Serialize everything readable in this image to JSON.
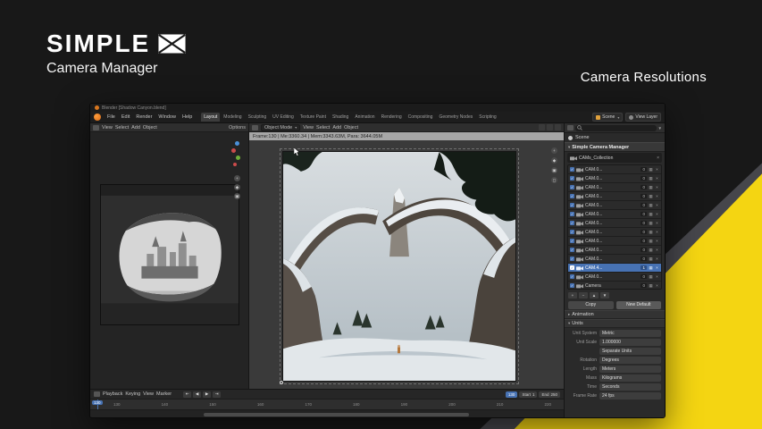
{
  "branding": {
    "title": "SIMPLE",
    "subtitle": "Camera Manager",
    "heading": "Camera Resolutions"
  },
  "colors": {
    "accent_yellow": "#F4D512",
    "accent_gray": "#46464B",
    "selection_blue": "#4772B3"
  },
  "window": {
    "title": "Blender  [Shadow Canyon.blend]"
  },
  "topbar": {
    "menus": [
      "File",
      "Edit",
      "Render",
      "Window",
      "Help"
    ],
    "workspaces": [
      {
        "label": "Layout",
        "active": true
      },
      {
        "label": "Modeling"
      },
      {
        "label": "Sculpting"
      },
      {
        "label": "UV Editing"
      },
      {
        "label": "Texture Paint"
      },
      {
        "label": "Shading"
      },
      {
        "label": "Animation"
      },
      {
        "label": "Rendering"
      },
      {
        "label": "Compositing"
      },
      {
        "label": "Geometry Nodes"
      },
      {
        "label": "Scripting"
      }
    ],
    "scene": "Scene",
    "view_layer": "View Layer"
  },
  "left_editor": {
    "menus": [
      "View",
      "Select",
      "Add",
      "Object"
    ],
    "options": "Options"
  },
  "viewport": {
    "menus": [
      "View",
      "Select",
      "Add",
      "Object"
    ],
    "mode": "Object Mode",
    "stats": "Frame:130 | Me:3360.34 | Mem:3343.63M, Para: 3644.05M"
  },
  "camera_panel": {
    "scene_label": "Scene",
    "title": "Simple Camera Manager",
    "collection_value": "CAMs_Collection",
    "cameras": [
      {
        "name": "CAM.0...",
        "slot": "0"
      },
      {
        "name": "CAM.0...",
        "slot": "0"
      },
      {
        "name": "CAM.0...",
        "slot": "0"
      },
      {
        "name": "CAM.0...",
        "slot": "0"
      },
      {
        "name": "CAM.0...",
        "slot": "0"
      },
      {
        "name": "CAM.0...",
        "slot": "0"
      },
      {
        "name": "CAM.0...",
        "slot": "0"
      },
      {
        "name": "CAM.0...",
        "slot": "0"
      },
      {
        "name": "CAM.0...",
        "slot": "0"
      },
      {
        "name": "CAM.0...",
        "slot": "0"
      },
      {
        "name": "CAM.0...",
        "slot": "0"
      },
      {
        "name": "CAM.4...",
        "slot": "1",
        "active": true
      },
      {
        "name": "CAM.0...",
        "slot": "0"
      },
      {
        "name": "Camera",
        "slot": "0"
      }
    ],
    "footer_icons": [
      "+",
      "−",
      "▲",
      "▼"
    ],
    "copy_button": "Copy",
    "new_default_button": "New Default",
    "section_animation": "Animation",
    "section_units": "Units",
    "units": [
      {
        "label": "Unit System",
        "value": "Metric"
      },
      {
        "label": "Unit Scale",
        "value": "1.000000"
      },
      {
        "label": "",
        "value": "Separate Units"
      },
      {
        "label": "Rotation",
        "value": "Degrees"
      },
      {
        "label": "Length",
        "value": "Meters"
      },
      {
        "label": "Mass",
        "value": "Kilograms"
      },
      {
        "label": "Time",
        "value": "Seconds"
      },
      {
        "label": "Frame Rate",
        "value": "24 fps"
      }
    ]
  },
  "timeline": {
    "menus": [
      "Playback",
      "Keying",
      "View",
      "Marker"
    ],
    "playback_icons": [
      "⇤",
      "◀",
      "▶",
      "⇥"
    ],
    "start_label": "Start",
    "start_value": "1",
    "end_label": "End",
    "end_value": "250",
    "current_frame": "130",
    "ticks": [
      "130",
      "140",
      "150",
      "160",
      "170",
      "180",
      "190",
      "200",
      "210",
      "220"
    ]
  }
}
